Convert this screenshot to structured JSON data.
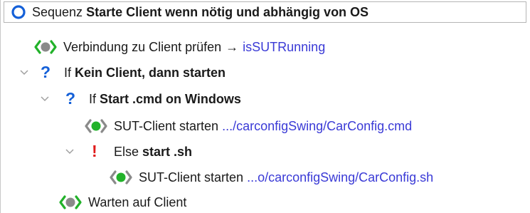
{
  "tree": {
    "rows": [
      {
        "prefix": "Sequenz",
        "name": "Starte Client wenn nötig und abhängig von OS",
        "icon": "sequence-ring-icon"
      },
      {
        "label": "Verbindung zu Client prüfen",
        "arrow": "→",
        "target": "isSUTRunning",
        "icon": "procedure-call-icon"
      },
      {
        "prefix": "If",
        "name": "Kein Client, dann starten",
        "icon": "question-icon",
        "twisty": "chevron-down-icon"
      },
      {
        "prefix": "If",
        "name": "Start .cmd on Windows",
        "icon": "question-icon",
        "twisty": "chevron-down-icon"
      },
      {
        "label": "SUT-Client starten",
        "path": ".../carconfigSwing/CarConfig.cmd",
        "icon": "start-client-icon"
      },
      {
        "prefix": "Else",
        "name": "start .sh",
        "icon": "exclamation-icon",
        "twisty": "chevron-down-icon"
      },
      {
        "label": "SUT-Client starten",
        "path": "...o/carconfigSwing/CarConfig.sh",
        "icon": "start-client-icon"
      },
      {
        "label": "Warten auf Client",
        "icon": "procedure-wait-icon"
      }
    ]
  },
  "colors": {
    "blue": "#1460d8",
    "green": "#22b22a",
    "grey": "#777777",
    "link": "#3a3ad6",
    "red": "#e01b1b"
  }
}
